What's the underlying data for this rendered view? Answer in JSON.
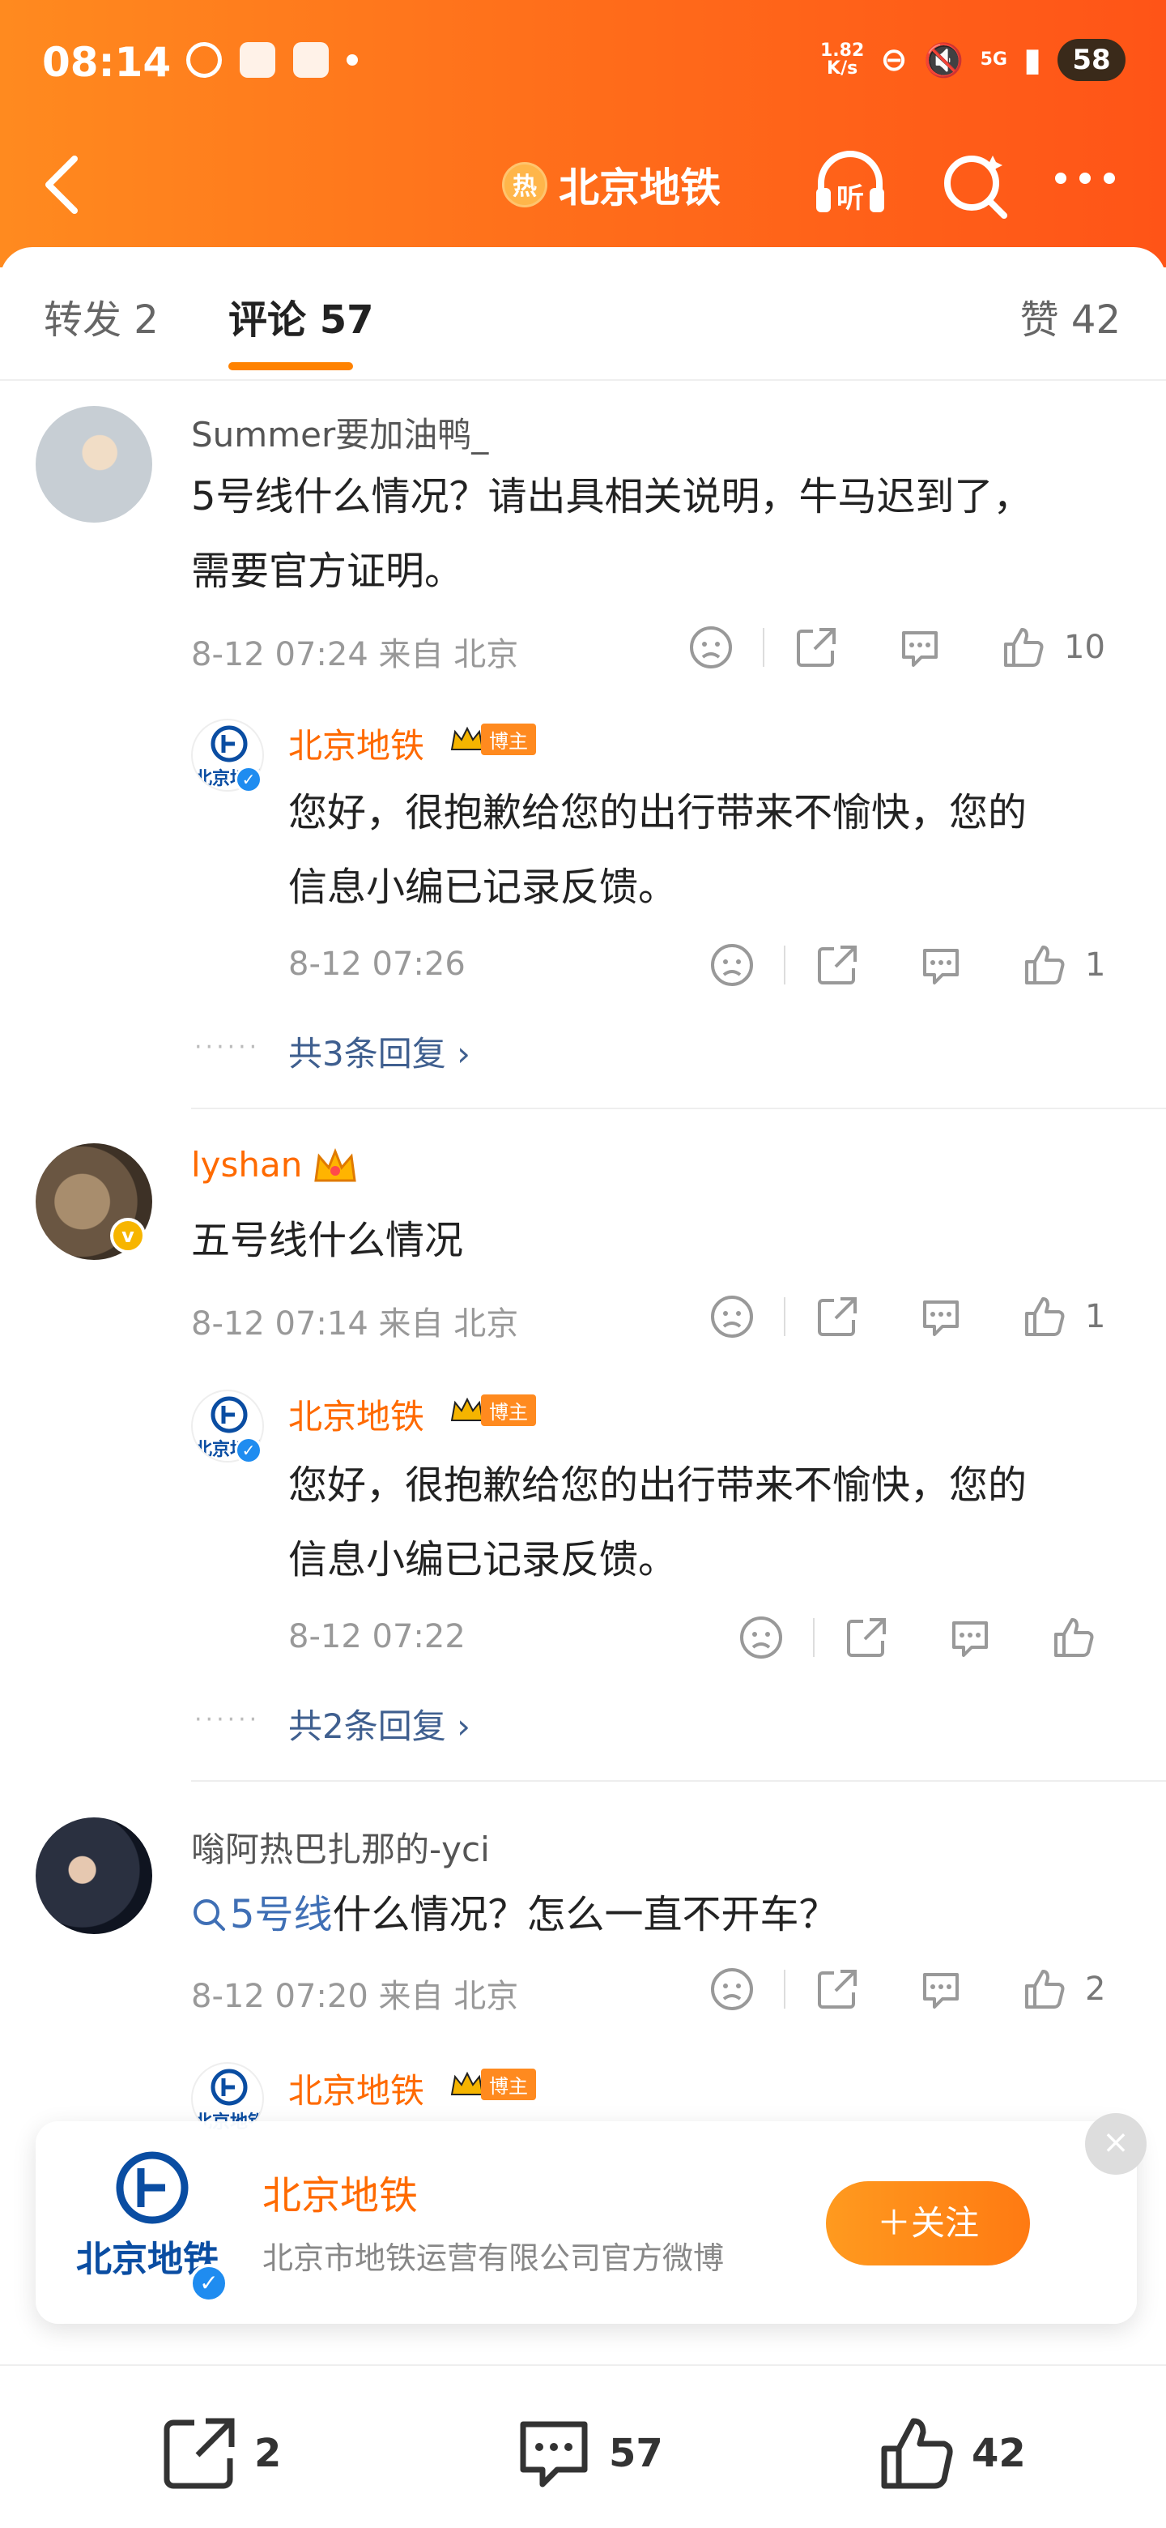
{
  "status_bar": {
    "time": "08:14",
    "net_speed": "1.82\nK/s",
    "battery": "58",
    "signal": "5G"
  },
  "nav": {
    "hot_badge": "热",
    "title": "北京地铁",
    "listen_label": "听"
  },
  "tabs": {
    "repost": "转发 2",
    "comments": "评论 57",
    "likes": "赞 42"
  },
  "comments": [
    {
      "username": "Summer要加油鸭_",
      "text_line1": "5号线什么情况？请出具相关说明，牛马迟到了，",
      "text_line2": "需要官方证明。",
      "meta": "8-12 07:24  来自 北京",
      "likes": "10",
      "reply": {
        "username": "北京地铁",
        "badge": "博主",
        "text_line1": "您好，很抱歉给您的出行带来不愉快，您的",
        "text_line2": "信息小编已记录反馈。",
        "meta": "8-12 07:26",
        "likes": "1"
      },
      "more_replies": "共3条回复 ›"
    },
    {
      "username": "lyshan",
      "text_line1": "五号线什么情况",
      "meta": "8-12 07:14  来自 北京",
      "likes": "1",
      "reply": {
        "username": "北京地铁",
        "badge": "博主",
        "text_line1": "您好，很抱歉给您的出行带来不愉快，您的",
        "text_line2": "信息小编已记录反馈。",
        "meta": "8-12 07:22",
        "likes": ""
      },
      "more_replies": "共2条回复 ›"
    },
    {
      "username": "嗡阿热巴扎那的-yci",
      "topic": "5号线",
      "text_line1": " 什么情况？怎么一直不开车？",
      "meta": "8-12 07:20  来自 北京",
      "likes": "2",
      "reply": {
        "username": "北京地铁",
        "badge": "博主"
      }
    }
  ],
  "reply_logo_text": "北京地铁",
  "follow_card": {
    "name": "北京地铁",
    "description": "北京市地铁运营有限公司官方微博",
    "button": "＋关注",
    "logo_text": "北京地铁",
    "close": "×"
  },
  "bottom_bar": {
    "repost_count": "2",
    "comment_count": "57",
    "like_count": "42"
  },
  "colors": {
    "header_orange": "#ff6a1a",
    "accent_orange": "#ff8200",
    "link_blue": "#3f5f8f",
    "verified_blue": "#1f8cf0"
  }
}
